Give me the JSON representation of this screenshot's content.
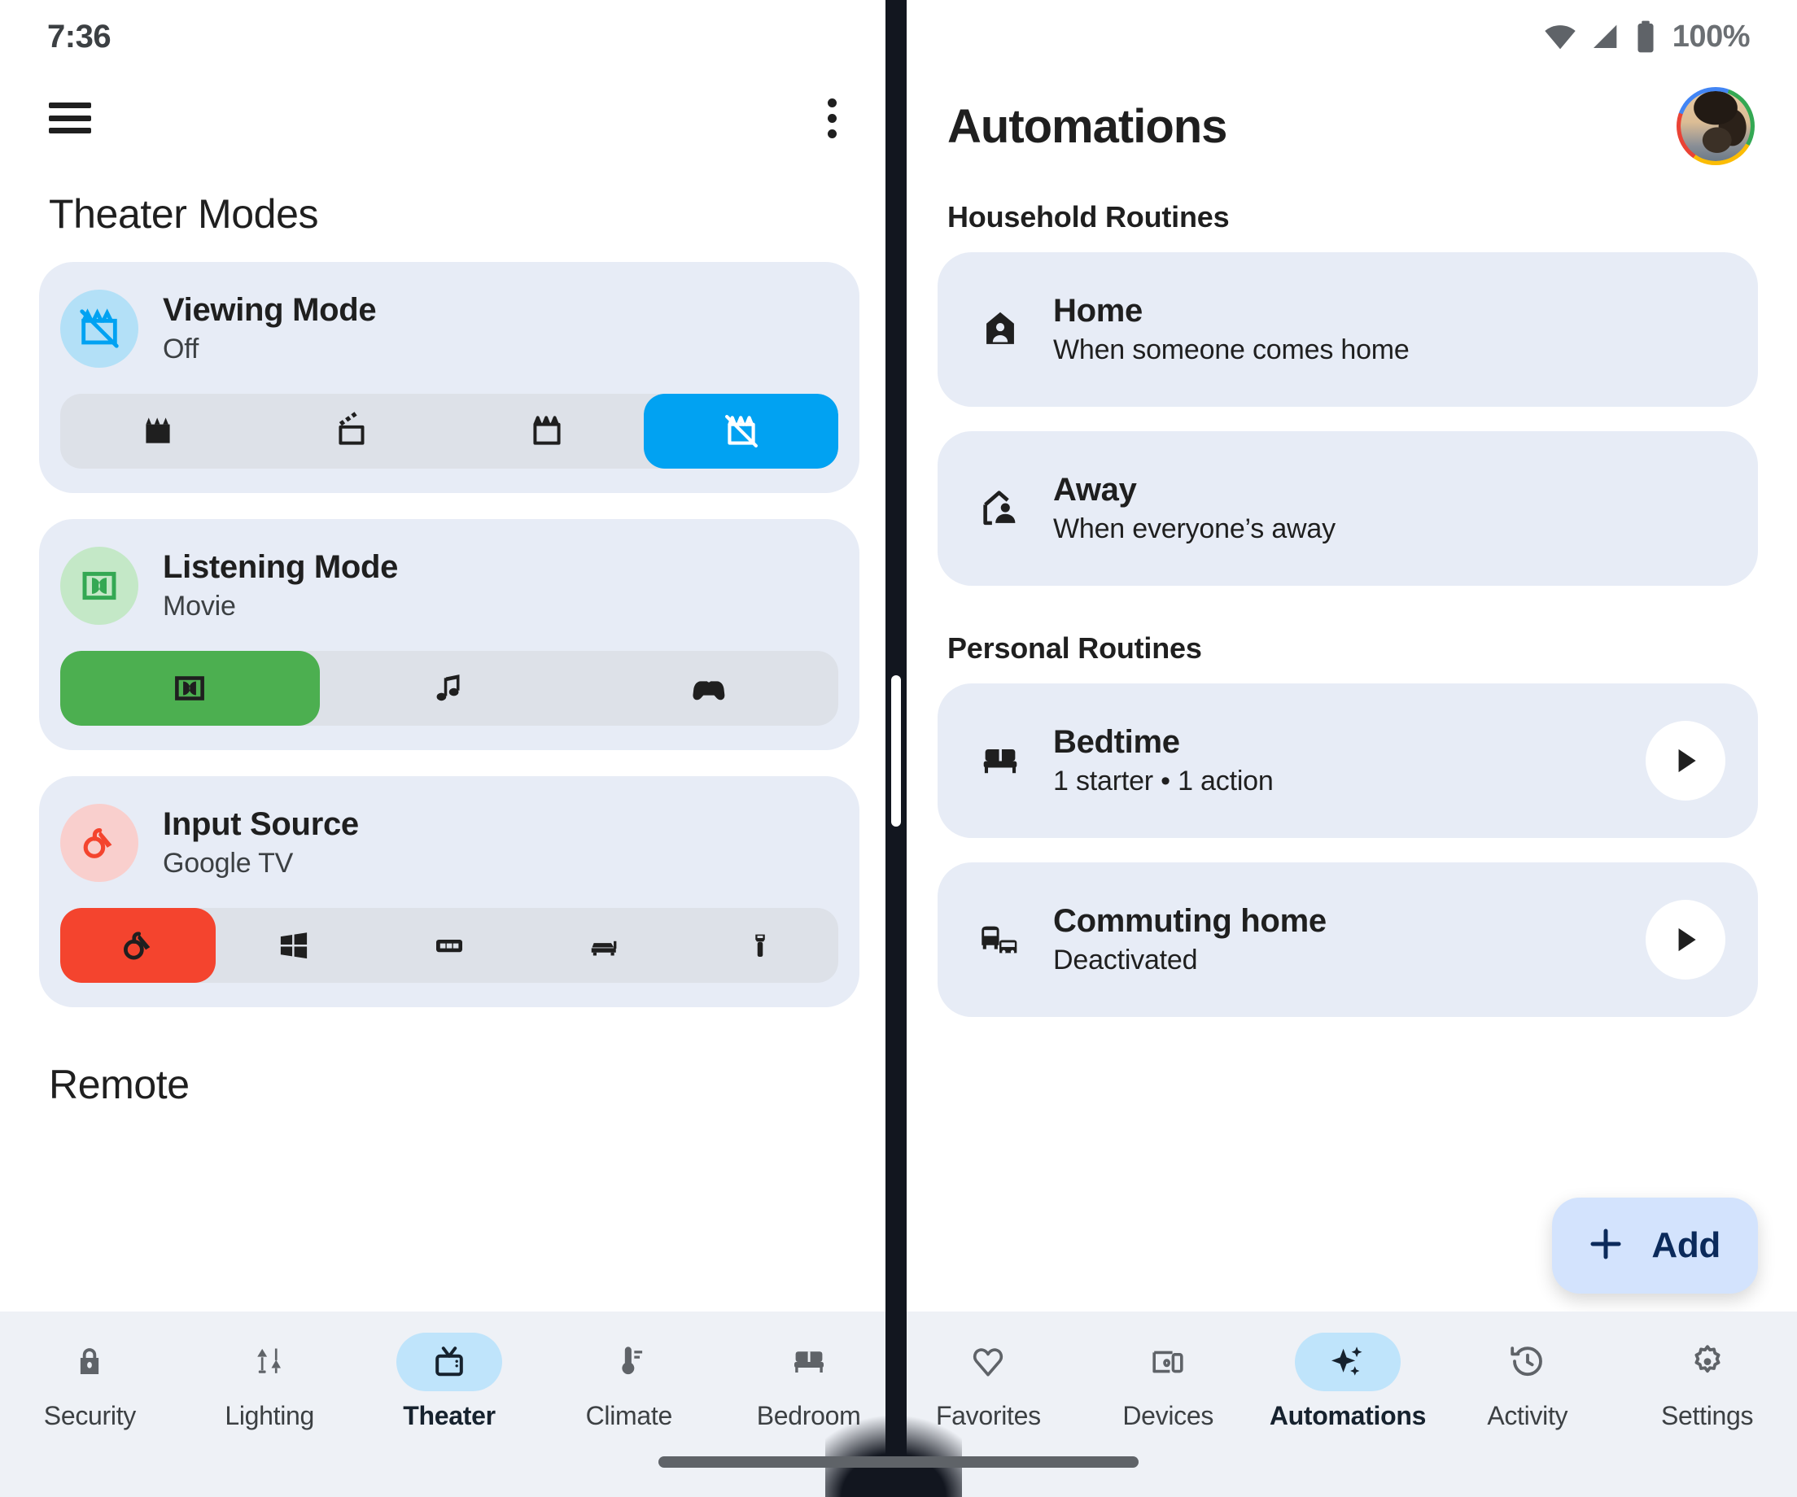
{
  "left": {
    "status": {
      "clock": "7:36"
    },
    "appbar": {
      "menu_icon": "hamburger-menu-icon",
      "overflow_icon": "more-vert-icon"
    },
    "section_title": "Theater Modes",
    "remote_title": "Remote",
    "cards": [
      {
        "name": "Viewing Mode",
        "value": "Off",
        "icon": "movie-off-icon",
        "accent": "#01a2f2",
        "options": [
          {
            "icon": "movie-filled-icon",
            "selected": false
          },
          {
            "icon": "movie-open-icon",
            "selected": false
          },
          {
            "icon": "movie-outline-icon",
            "selected": false
          },
          {
            "icon": "movie-off-icon",
            "selected": true
          }
        ]
      },
      {
        "name": "Listening Mode",
        "value": "Movie",
        "icon": "dolby-surround-icon",
        "accent": "#4caf50",
        "options": [
          {
            "icon": "dolby-surround-icon",
            "selected": true
          },
          {
            "icon": "music-note-icon",
            "selected": false
          },
          {
            "icon": "game-controller-icon",
            "selected": false
          }
        ]
      },
      {
        "name": "Input Source",
        "value": "Google TV",
        "icon": "cast-dongle-icon",
        "accent": "#f4442e",
        "options": [
          {
            "icon": "cast-dongle-icon",
            "selected": true
          },
          {
            "icon": "windows-logo-icon",
            "selected": false
          },
          {
            "icon": "media-box-icon",
            "selected": false
          },
          {
            "icon": "soundbar-icon",
            "selected": false
          },
          {
            "icon": "hdmi-plug-icon",
            "selected": false
          }
        ]
      }
    ],
    "nav": [
      {
        "label": "Security",
        "icon": "lock-icon",
        "active": false
      },
      {
        "label": "Lighting",
        "icon": "lamps-icon",
        "active": false
      },
      {
        "label": "Theater",
        "icon": "tv-icon",
        "active": true
      },
      {
        "label": "Climate",
        "icon": "thermostat-icon",
        "active": false
      },
      {
        "label": "Bedroom",
        "icon": "bed-icon",
        "active": false
      }
    ]
  },
  "right": {
    "status": {
      "wifi_icon": "wifi-icon",
      "signal_icon": "cellular-signal-icon",
      "battery_icon": "battery-full-icon",
      "battery": "100%"
    },
    "title": "Automations",
    "avatar": "user-avatar",
    "groups": [
      {
        "heading": "Household Routines",
        "items": [
          {
            "title": "Home",
            "subtitle": "When someone comes home",
            "icon": "home-person-icon",
            "play": false
          },
          {
            "title": "Away",
            "subtitle": "When everyone’s away",
            "icon": "home-away-icon",
            "play": false
          }
        ]
      },
      {
        "heading": "Personal Routines",
        "items": [
          {
            "title": "Bedtime",
            "subtitle": "1 starter • 1 action",
            "icon": "bed-icon",
            "play": true
          },
          {
            "title": "Commuting home",
            "subtitle": "Deactivated",
            "icon": "commute-icon",
            "play": true
          }
        ]
      }
    ],
    "fab": {
      "label": "Add",
      "icon": "plus-icon"
    },
    "nav": [
      {
        "label": "Favorites",
        "icon": "heart-icon",
        "active": false
      },
      {
        "label": "Devices",
        "icon": "devices-icon",
        "active": false
      },
      {
        "label": "Automations",
        "icon": "sparkle-icon",
        "active": true
      },
      {
        "label": "Activity",
        "icon": "history-icon",
        "active": false
      },
      {
        "label": "Settings",
        "icon": "gear-icon",
        "active": false
      }
    ]
  }
}
